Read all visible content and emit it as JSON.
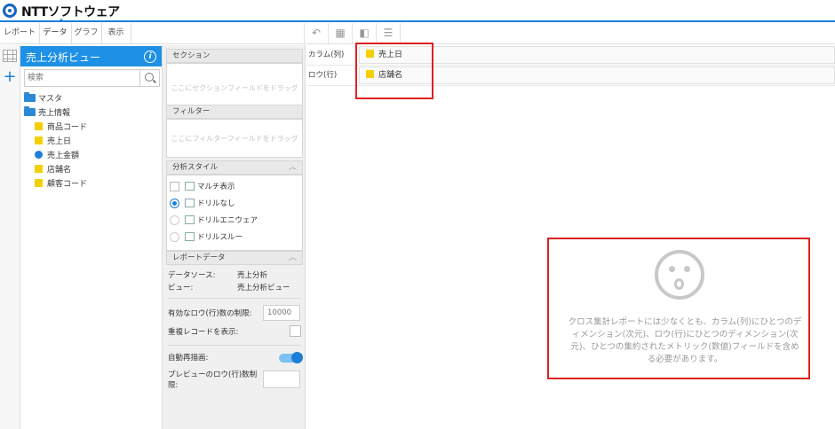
{
  "header": {
    "logo_text": "NTTソフトウェア"
  },
  "menu": {
    "items": [
      "レポート",
      "データ",
      "グラフ",
      "表示"
    ],
    "active": "データ"
  },
  "toolbar": {
    "icons": [
      "undo-icon",
      "table-icon",
      "layout-icon",
      "list-icon"
    ]
  },
  "view_panel": {
    "title": "売上分析ビュー",
    "search_placeholder": "検索",
    "tree": {
      "folder_master": "マスタ",
      "folder_sales": "売上情報",
      "fields": [
        {
          "label": "商品コード",
          "kind": "dimension"
        },
        {
          "label": "売上日",
          "kind": "dimension"
        },
        {
          "label": "売上金額",
          "kind": "metric"
        },
        {
          "label": "店舗名",
          "kind": "dimension"
        },
        {
          "label": "顧客コード",
          "kind": "dimension"
        }
      ]
    }
  },
  "config": {
    "section_header": "セクション",
    "section_drop_hint": "ここにセクションフィールドをドラッグ",
    "filter_header": "フィルター",
    "filter_drop_hint": "ここにフィルターフィールドをドラッグ",
    "style_header": "分析スタイル",
    "multi_view_label": "マルチ表示",
    "options": [
      "ドリルなし",
      "ドリルエニウェア",
      "ドリルスルー"
    ],
    "selected_option": "ドリルなし",
    "report_data_header": "レポートデータ",
    "datasource_label": "データソース:",
    "datasource_value": "売上分析",
    "view_label": "ビュー:",
    "view_value": "売上分析ビュー",
    "row_limit_label": "有効なロウ(行)数の制限:",
    "row_limit_value": "10000",
    "show_duplicates_label": "重複レコードを表示:",
    "auto_redraw_label": "自動再描画:",
    "auto_redraw_on": true,
    "preview_limit_label_1": "プレビューのロウ(行)数制",
    "preview_limit_label_2": "限:"
  },
  "shelves": {
    "column_label": "カラム(列)",
    "column_field": "売上日",
    "row_label": "ロウ(行)",
    "row_field": "店舗名"
  },
  "empty_state": {
    "icon": "surprised-face-icon",
    "message": "クロス集計レポートには少なくとも、カラム(列)にひとつのディメンション(次元)、ロウ(行)にひとつのディメンション(次元)、ひとつの集約されたメトリック(数値)フィールドを含める必要があります。"
  },
  "colors": {
    "accent": "#1e90e6",
    "dimension": "#f5d000",
    "metric": "#1e7fd6",
    "highlight": "#e02020"
  }
}
